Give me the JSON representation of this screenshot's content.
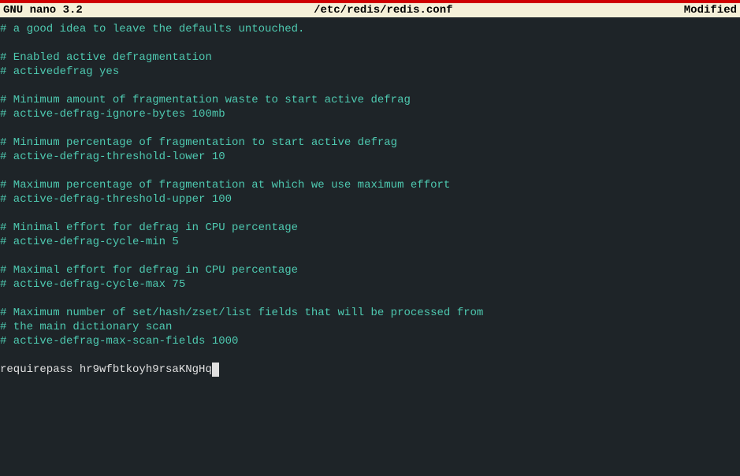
{
  "titlebar": {
    "left": "  GNU nano 3.2",
    "center": "/etc/redis/redis.conf",
    "right": "Modified  "
  },
  "lines": [
    {
      "text": "# a good idea to leave the defaults untouched.",
      "type": "comment"
    },
    {
      "text": "",
      "type": "blank"
    },
    {
      "text": "# Enabled active defragmentation",
      "type": "comment"
    },
    {
      "text": "# activedefrag yes",
      "type": "comment"
    },
    {
      "text": "",
      "type": "blank"
    },
    {
      "text": "# Minimum amount of fragmentation waste to start active defrag",
      "type": "comment"
    },
    {
      "text": "# active-defrag-ignore-bytes 100mb",
      "type": "comment"
    },
    {
      "text": "",
      "type": "blank"
    },
    {
      "text": "# Minimum percentage of fragmentation to start active defrag",
      "type": "comment"
    },
    {
      "text": "# active-defrag-threshold-lower 10",
      "type": "comment"
    },
    {
      "text": "",
      "type": "blank"
    },
    {
      "text": "# Maximum percentage of fragmentation at which we use maximum effort",
      "type": "comment"
    },
    {
      "text": "# active-defrag-threshold-upper 100",
      "type": "comment"
    },
    {
      "text": "",
      "type": "blank"
    },
    {
      "text": "# Minimal effort for defrag in CPU percentage",
      "type": "comment"
    },
    {
      "text": "# active-defrag-cycle-min 5",
      "type": "comment"
    },
    {
      "text": "",
      "type": "blank"
    },
    {
      "text": "# Maximal effort for defrag in CPU percentage",
      "type": "comment"
    },
    {
      "text": "# active-defrag-cycle-max 75",
      "type": "comment"
    },
    {
      "text": "",
      "type": "blank"
    },
    {
      "text": "# Maximum number of set/hash/zset/list fields that will be processed from",
      "type": "comment"
    },
    {
      "text": "# the main dictionary scan",
      "type": "comment"
    },
    {
      "text": "# active-defrag-max-scan-fields 1000",
      "type": "comment"
    },
    {
      "text": "",
      "type": "blank"
    },
    {
      "text": "requirepass hr9wfbtkoyh9rsaKNgHq",
      "type": "plain",
      "cursor": true
    }
  ]
}
